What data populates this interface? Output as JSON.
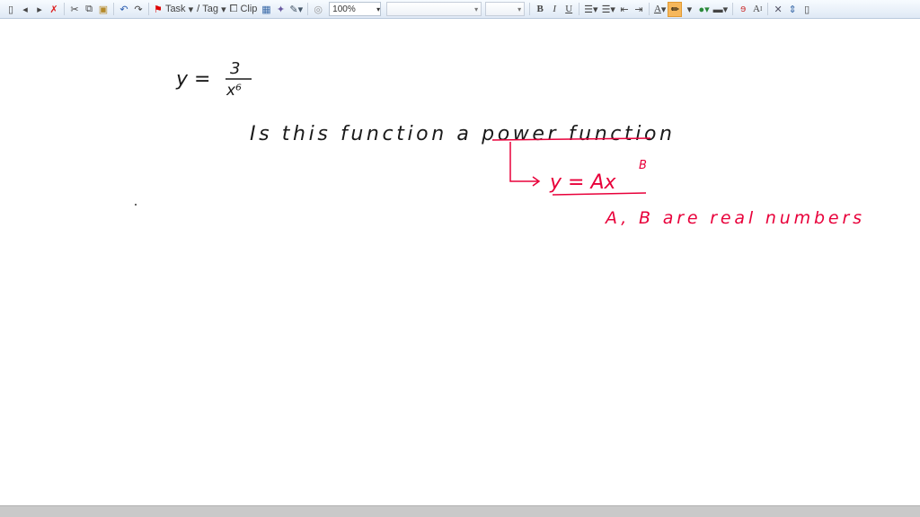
{
  "toolbar": {
    "task_label": "Task",
    "tag_label": "Tag",
    "clip_label": "Clip",
    "zoom_value": "100%",
    "font_name": "",
    "font_size": "",
    "bold": "B",
    "italic": "I",
    "underline": "U",
    "font_color": "A",
    "superscript": "A",
    "pen_color": "#000000",
    "highlight_color": "#f6b75b"
  },
  "note": {
    "equation_y": "y =",
    "numerator": "3",
    "denominator": "x⁶",
    "question": "Is   this  function   a  power function",
    "form": "y = Ax",
    "form_exponent": "B",
    "condition": "A, B  are  real numbers",
    "ink_black": "#1a1a1a",
    "ink_red": "#e8003a"
  }
}
